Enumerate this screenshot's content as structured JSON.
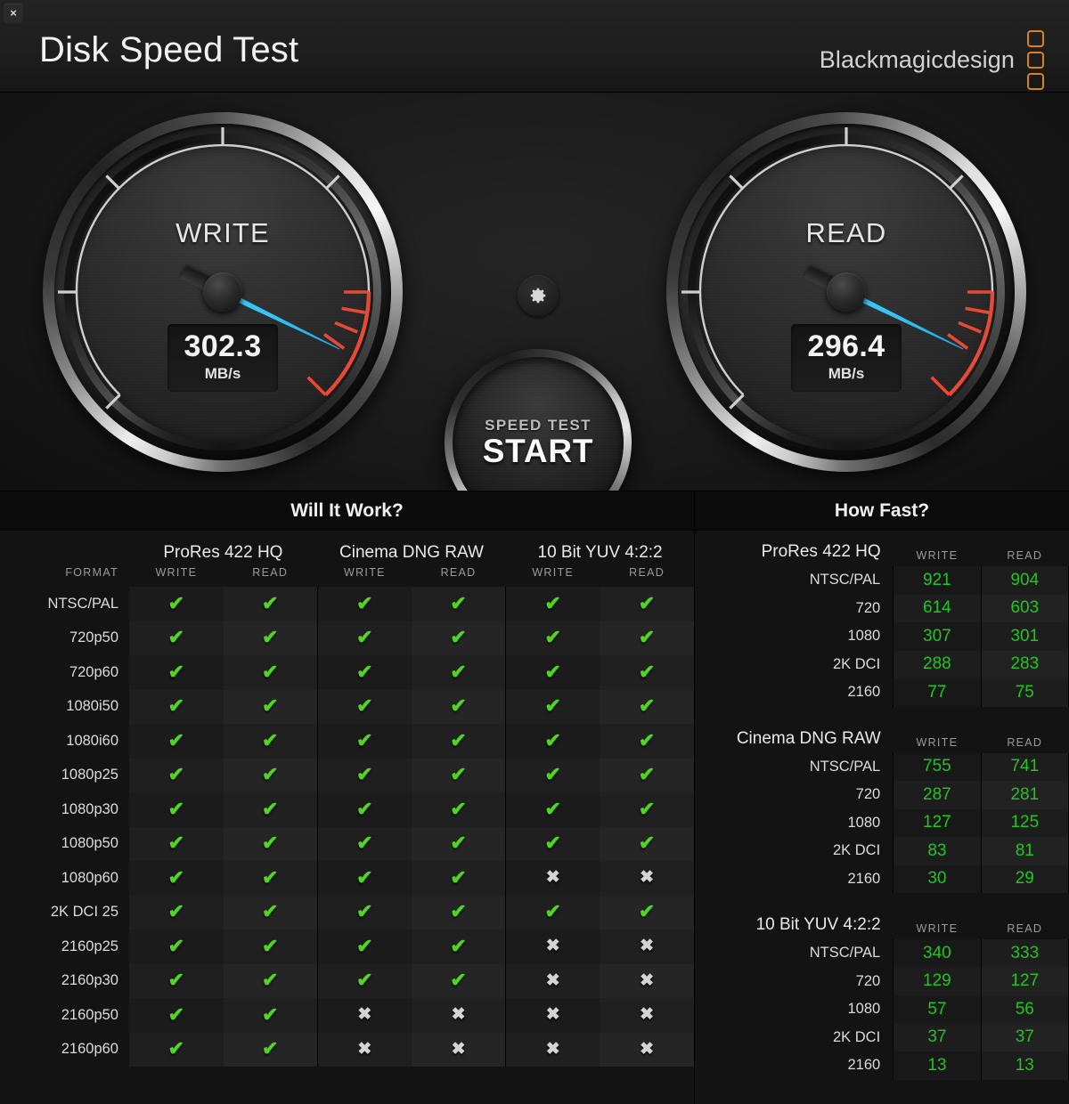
{
  "window": {
    "title": "Disk Speed Test",
    "close_label": "×",
    "brand": "Blackmagicdesign",
    "brand_accent": "#d98319"
  },
  "gauges": {
    "write": {
      "label": "WRITE",
      "value": "302.3",
      "unit": "MB/s",
      "needle_color": "#34c4f5",
      "needle_angle_deg": 206,
      "redzone_color": "#e64a35"
    },
    "read": {
      "label": "READ",
      "value": "296.4",
      "unit": "MB/s",
      "needle_color": "#34c4f5",
      "needle_angle_deg": 206,
      "redzone_color": "#e64a35"
    }
  },
  "controls": {
    "settings_icon": "gear-icon",
    "start_sub": "SPEED TEST",
    "start_main": "START"
  },
  "will_it_work": {
    "title": "Will It Work?",
    "format_header": "FORMAT",
    "codecs": [
      "ProRes 422 HQ",
      "Cinema DNG RAW",
      "10 Bit YUV 4:2:2"
    ],
    "sub_headers": [
      "WRITE",
      "READ"
    ],
    "ok_glyph": "✔",
    "no_glyph": "✖",
    "ok_color": "#4fd61f",
    "no_color": "#d4d4d4",
    "rows": [
      {
        "format": "NTSC/PAL",
        "cells": [
          true,
          true,
          true,
          true,
          true,
          true
        ]
      },
      {
        "format": "720p50",
        "cells": [
          true,
          true,
          true,
          true,
          true,
          true
        ]
      },
      {
        "format": "720p60",
        "cells": [
          true,
          true,
          true,
          true,
          true,
          true
        ]
      },
      {
        "format": "1080i50",
        "cells": [
          true,
          true,
          true,
          true,
          true,
          true
        ]
      },
      {
        "format": "1080i60",
        "cells": [
          true,
          true,
          true,
          true,
          true,
          true
        ]
      },
      {
        "format": "1080p25",
        "cells": [
          true,
          true,
          true,
          true,
          true,
          true
        ]
      },
      {
        "format": "1080p30",
        "cells": [
          true,
          true,
          true,
          true,
          true,
          true
        ]
      },
      {
        "format": "1080p50",
        "cells": [
          true,
          true,
          true,
          true,
          true,
          true
        ]
      },
      {
        "format": "1080p60",
        "cells": [
          true,
          true,
          true,
          true,
          false,
          false
        ]
      },
      {
        "format": "2K DCI 25",
        "cells": [
          true,
          true,
          true,
          true,
          true,
          true
        ]
      },
      {
        "format": "2160p25",
        "cells": [
          true,
          true,
          true,
          true,
          false,
          false
        ]
      },
      {
        "format": "2160p30",
        "cells": [
          true,
          true,
          true,
          true,
          false,
          false
        ]
      },
      {
        "format": "2160p50",
        "cells": [
          true,
          true,
          false,
          false,
          false,
          false
        ]
      },
      {
        "format": "2160p60",
        "cells": [
          true,
          true,
          false,
          false,
          false,
          false
        ]
      }
    ]
  },
  "how_fast": {
    "title": "How Fast?",
    "col_write": "WRITE",
    "col_read": "READ",
    "value_color": "#22c422",
    "sections": [
      {
        "codec": "ProRes 422 HQ",
        "rows": [
          {
            "res": "NTSC/PAL",
            "write": "921",
            "read": "904"
          },
          {
            "res": "720",
            "write": "614",
            "read": "603"
          },
          {
            "res": "1080",
            "write": "307",
            "read": "301"
          },
          {
            "res": "2K DCI",
            "write": "288",
            "read": "283"
          },
          {
            "res": "2160",
            "write": "77",
            "read": "75"
          }
        ]
      },
      {
        "codec": "Cinema DNG RAW",
        "rows": [
          {
            "res": "NTSC/PAL",
            "write": "755",
            "read": "741"
          },
          {
            "res": "720",
            "write": "287",
            "read": "281"
          },
          {
            "res": "1080",
            "write": "127",
            "read": "125"
          },
          {
            "res": "2K DCI",
            "write": "83",
            "read": "81"
          },
          {
            "res": "2160",
            "write": "30",
            "read": "29"
          }
        ]
      },
      {
        "codec": "10 Bit YUV 4:2:2",
        "rows": [
          {
            "res": "NTSC/PAL",
            "write": "340",
            "read": "333"
          },
          {
            "res": "720",
            "write": "129",
            "read": "127"
          },
          {
            "res": "1080",
            "write": "57",
            "read": "56"
          },
          {
            "res": "2K DCI",
            "write": "37",
            "read": "37"
          },
          {
            "res": "2160",
            "write": "13",
            "read": "13"
          }
        ]
      }
    ]
  }
}
